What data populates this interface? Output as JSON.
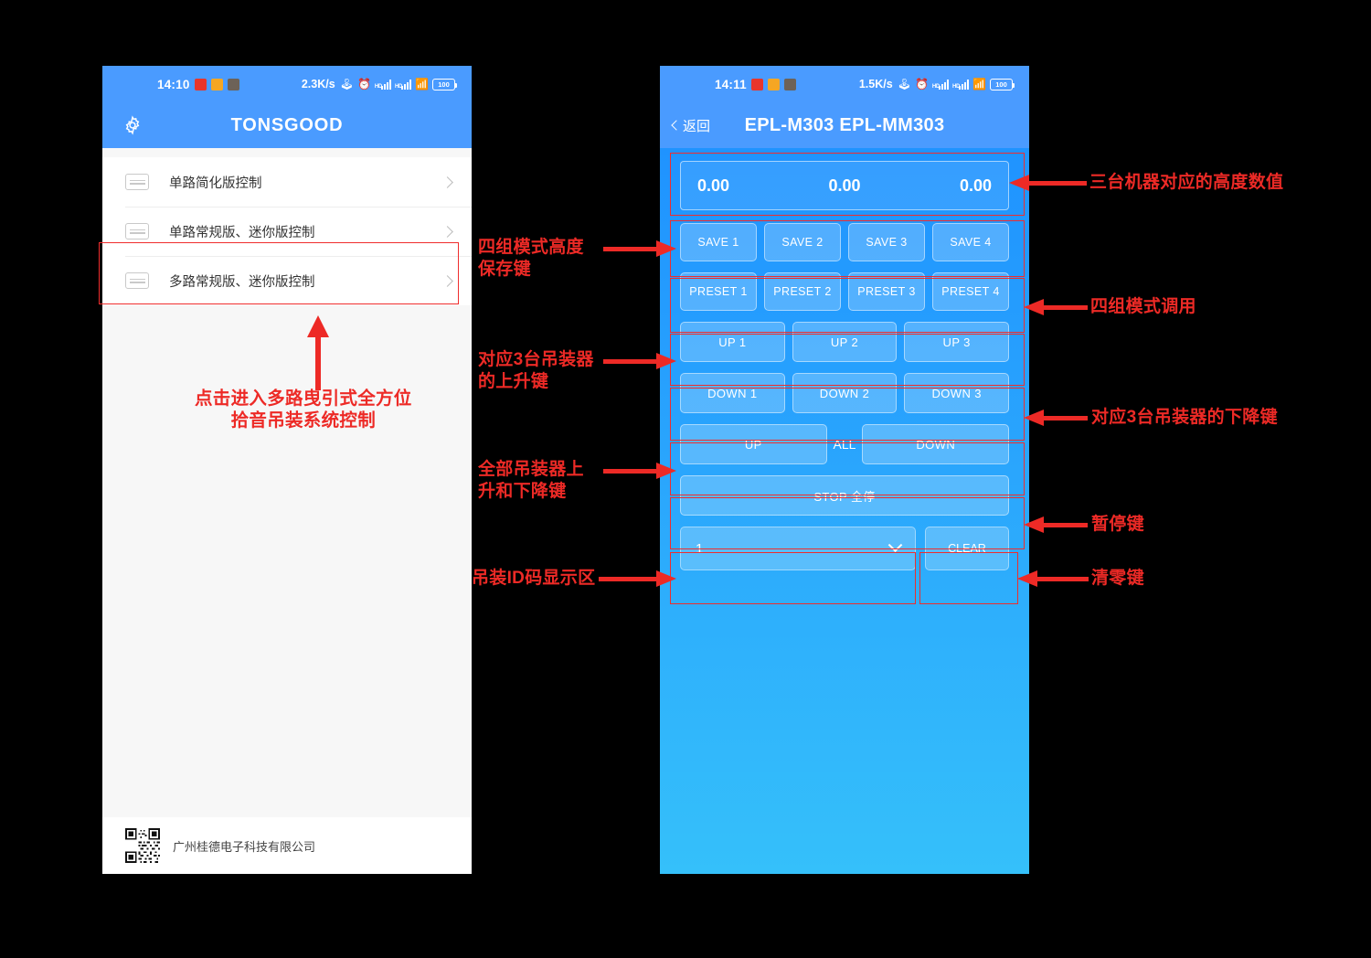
{
  "left_phone": {
    "statusbar": {
      "time": "14:10",
      "speed": "2.3K/s",
      "battery": "100",
      "icons": [
        "red-square-icon",
        "orange-square-icon",
        "gray-square-icon",
        "bluetooth-icon",
        "alarm-icon",
        "hd-signal-icon-1",
        "hd-signal-icon-2",
        "wifi-icon",
        "battery-icon"
      ]
    },
    "appbar": {
      "title": "TONSGOOD",
      "gear": "gear-icon"
    },
    "list": [
      {
        "label": "单路简化版控制"
      },
      {
        "label": "单路常规版、迷你版控制"
      },
      {
        "label": "多路常规版、迷你版控制"
      }
    ],
    "footer": {
      "company": "广州桂德电子科技有限公司"
    }
  },
  "right_phone": {
    "statusbar": {
      "time": "14:11",
      "speed": "1.5K/s",
      "battery": "100"
    },
    "appbar": {
      "back": "返回",
      "title": "EPL-M303 EPL-MM303"
    },
    "readout": [
      "0.00",
      "0.00",
      "0.00"
    ],
    "save_buttons": [
      "SAVE 1",
      "SAVE 2",
      "SAVE 3",
      "SAVE 4"
    ],
    "preset_buttons": [
      "PRESET 1",
      "PRESET 2",
      "PRESET 3",
      "PRESET 4"
    ],
    "up_buttons": [
      "UP 1",
      "UP 2",
      "UP 3"
    ],
    "down_buttons": [
      "DOWN 1",
      "DOWN 2",
      "DOWN 3"
    ],
    "all_row": {
      "up": "UP",
      "label": "ALL",
      "down": "DOWN"
    },
    "stop_button": "STOP 全停",
    "select": {
      "value": "1"
    },
    "clear_button": "CLEAR"
  },
  "annotations": {
    "left_cta": "点击进入多路曳引式全方位\n拾音吊装系统控制",
    "height_values": "三台机器对应的高度数值",
    "save_group": "四组模式高度\n保存键",
    "preset_group": "四组模式调用",
    "up_group": "对应3台吊装器\n的上升键",
    "down_group": "对应3台吊装器的下降键",
    "all_group": "全部吊装器上\n升和下降键",
    "stop_group": "暂停键",
    "id_group": "吊装ID码显示区",
    "clear_group": "清零键"
  },
  "colors": {
    "accent_red": "#ed2a26",
    "brand_blue": "#4a9bff",
    "gradient_top": "#1f93ff",
    "gradient_bottom": "#35c0fa"
  }
}
